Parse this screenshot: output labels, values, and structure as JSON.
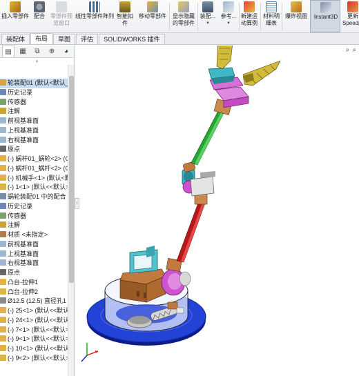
{
  "ribbon": {
    "items": [
      {
        "label": "插入零部件",
        "icon": "insert-component-icon"
      },
      {
        "label": "配合",
        "icon": "mate-icon"
      },
      {
        "label": "零部件预览窗口",
        "icon": "component-preview-icon",
        "disabled": true
      },
      {
        "label": "线性零部件阵列",
        "icon": "linear-pattern-icon"
      },
      {
        "label": "智能扣件",
        "icon": "smart-fastener-icon"
      },
      {
        "label": "移动零部件",
        "icon": "move-component-icon"
      },
      {
        "label": "显示隐藏的零部件",
        "icon": "show-hidden-icon"
      },
      {
        "label": "装配...",
        "icon": "assembly-feature-icon"
      },
      {
        "label": "参考...",
        "icon": "reference-geometry-icon"
      },
      {
        "label": "新建运动算例",
        "icon": "motion-study-icon"
      },
      {
        "label": "材料明细表",
        "icon": "bom-icon"
      },
      {
        "label": "爆炸视图",
        "icon": "exploded-view-icon"
      },
      {
        "label": "Instant3D",
        "icon": "instant3d-icon"
      },
      {
        "label": "更新Speedpak",
        "icon": "speedpak-icon"
      }
    ]
  },
  "tabs": [
    "装配体",
    "布局",
    "草图",
    "评估",
    "SOLIDWORKS 插件"
  ],
  "panel": {
    "tab_icons": [
      "feature-manager-icon",
      "property-manager-icon",
      "config-manager-icon",
      "dimxpert-icon",
      "display-manager-icon"
    ],
    "tree": [
      {
        "label": "轮装配01 (默认<默认_显示",
        "icon": "assembly-icon",
        "selected": true
      },
      {
        "label": "历史记录",
        "icon": "history-icon"
      },
      {
        "label": "传感器",
        "icon": "sensor-icon"
      },
      {
        "label": "注解",
        "icon": "annotation-icon"
      },
      {
        "label": "前视基准面",
        "icon": "plane-icon"
      },
      {
        "label": "上视基准面",
        "icon": "plane-icon"
      },
      {
        "label": "右视基准面",
        "icon": "plane-icon"
      },
      {
        "label": "原点",
        "icon": "origin-icon"
      },
      {
        "label": "(-) 蜗杆01_蜗轮<2> (Gea",
        "icon": "part-icon"
      },
      {
        "label": "(-) 蜗杆01_蜗杆<2> (Gea",
        "icon": "part-icon"
      },
      {
        "label": "(-) 机械手<1> (默认<默认",
        "icon": "part-icon"
      },
      {
        "label": "(-) 1<1> (默认<<默认>_",
        "icon": "part-icon"
      },
      {
        "label": "蜗轮装配01 中的配合",
        "icon": "mates-icon"
      },
      {
        "label": "历史记录",
        "icon": "history-icon"
      },
      {
        "label": "传感器",
        "icon": "sensor-icon"
      },
      {
        "label": "注解",
        "icon": "annotation-icon"
      },
      {
        "label": "材质 <未指定>",
        "icon": "material-icon"
      },
      {
        "label": "前视基准面",
        "icon": "plane-icon"
      },
      {
        "label": "上视基准面",
        "icon": "plane-icon"
      },
      {
        "label": "右视基准面",
        "icon": "plane-icon"
      },
      {
        "label": "原点",
        "icon": "origin-icon"
      },
      {
        "label": "凸台-拉伸1",
        "icon": "extrude-icon"
      },
      {
        "label": "凸台-拉伸2",
        "icon": "extrude-icon"
      },
      {
        "label": "Ø12.5 (12.5) 直径孔1",
        "icon": "hole-icon"
      },
      {
        "label": "(-) 25<1> (默认<<默认>_",
        "icon": "part-icon"
      },
      {
        "label": "(-) 24<1> (默认<<默认>_",
        "icon": "part-icon"
      },
      {
        "label": "(-) 7<1> (默认<<默认>_",
        "icon": "part-icon"
      },
      {
        "label": "(-) 9<1> (默认<<默认>_",
        "icon": "part-icon"
      },
      {
        "label": "(-) 10<1> (默认<<默认>_",
        "icon": "part-icon"
      },
      {
        "label": "(-) 9<2> (默认<<默认>_",
        "icon": "part-icon"
      }
    ]
  },
  "colors": {
    "base_plate": "#1f3fcf",
    "base_cylinder": "#dfe6ff",
    "arm_red": "#d42020",
    "arm_green": "#2fae3a",
    "joint_brown": "#c0763c",
    "gripper_yellow": "#c9b233",
    "gripper_magenta": "#d84fd8",
    "cyan_part": "#46b7c4",
    "selected_row": "#c8ddf2"
  }
}
